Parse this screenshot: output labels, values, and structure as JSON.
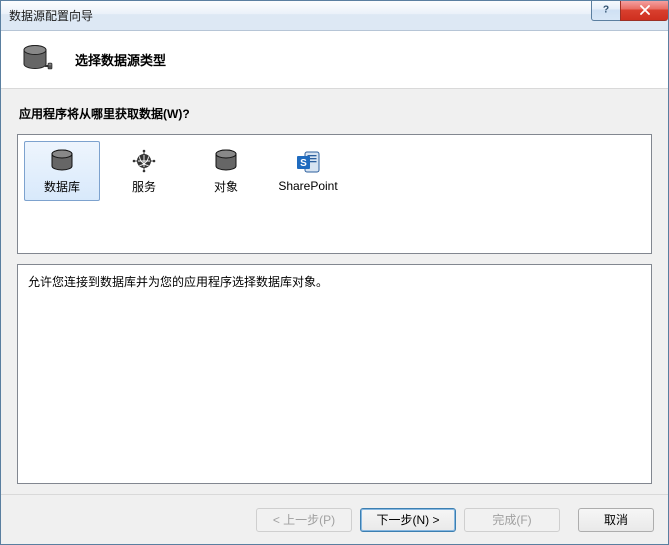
{
  "window": {
    "title": "数据源配置向导"
  },
  "header": {
    "title": "选择数据源类型"
  },
  "body": {
    "prompt": "应用程序将从哪里获取数据(W)?",
    "options": [
      {
        "id": "database",
        "label": "数据库",
        "selected": true
      },
      {
        "id": "service",
        "label": "服务",
        "selected": false
      },
      {
        "id": "object",
        "label": "对象",
        "selected": false
      },
      {
        "id": "sharepoint",
        "label": "SharePoint",
        "selected": false
      }
    ],
    "description": "允许您连接到数据库并为您的应用程序选择数据库对象。"
  },
  "footer": {
    "previous": "< 上一步(P)",
    "next": "下一步(N) >",
    "finish": "完成(F)",
    "cancel": "取消",
    "previous_enabled": false,
    "next_enabled": true,
    "finish_enabled": false,
    "cancel_enabled": true
  }
}
